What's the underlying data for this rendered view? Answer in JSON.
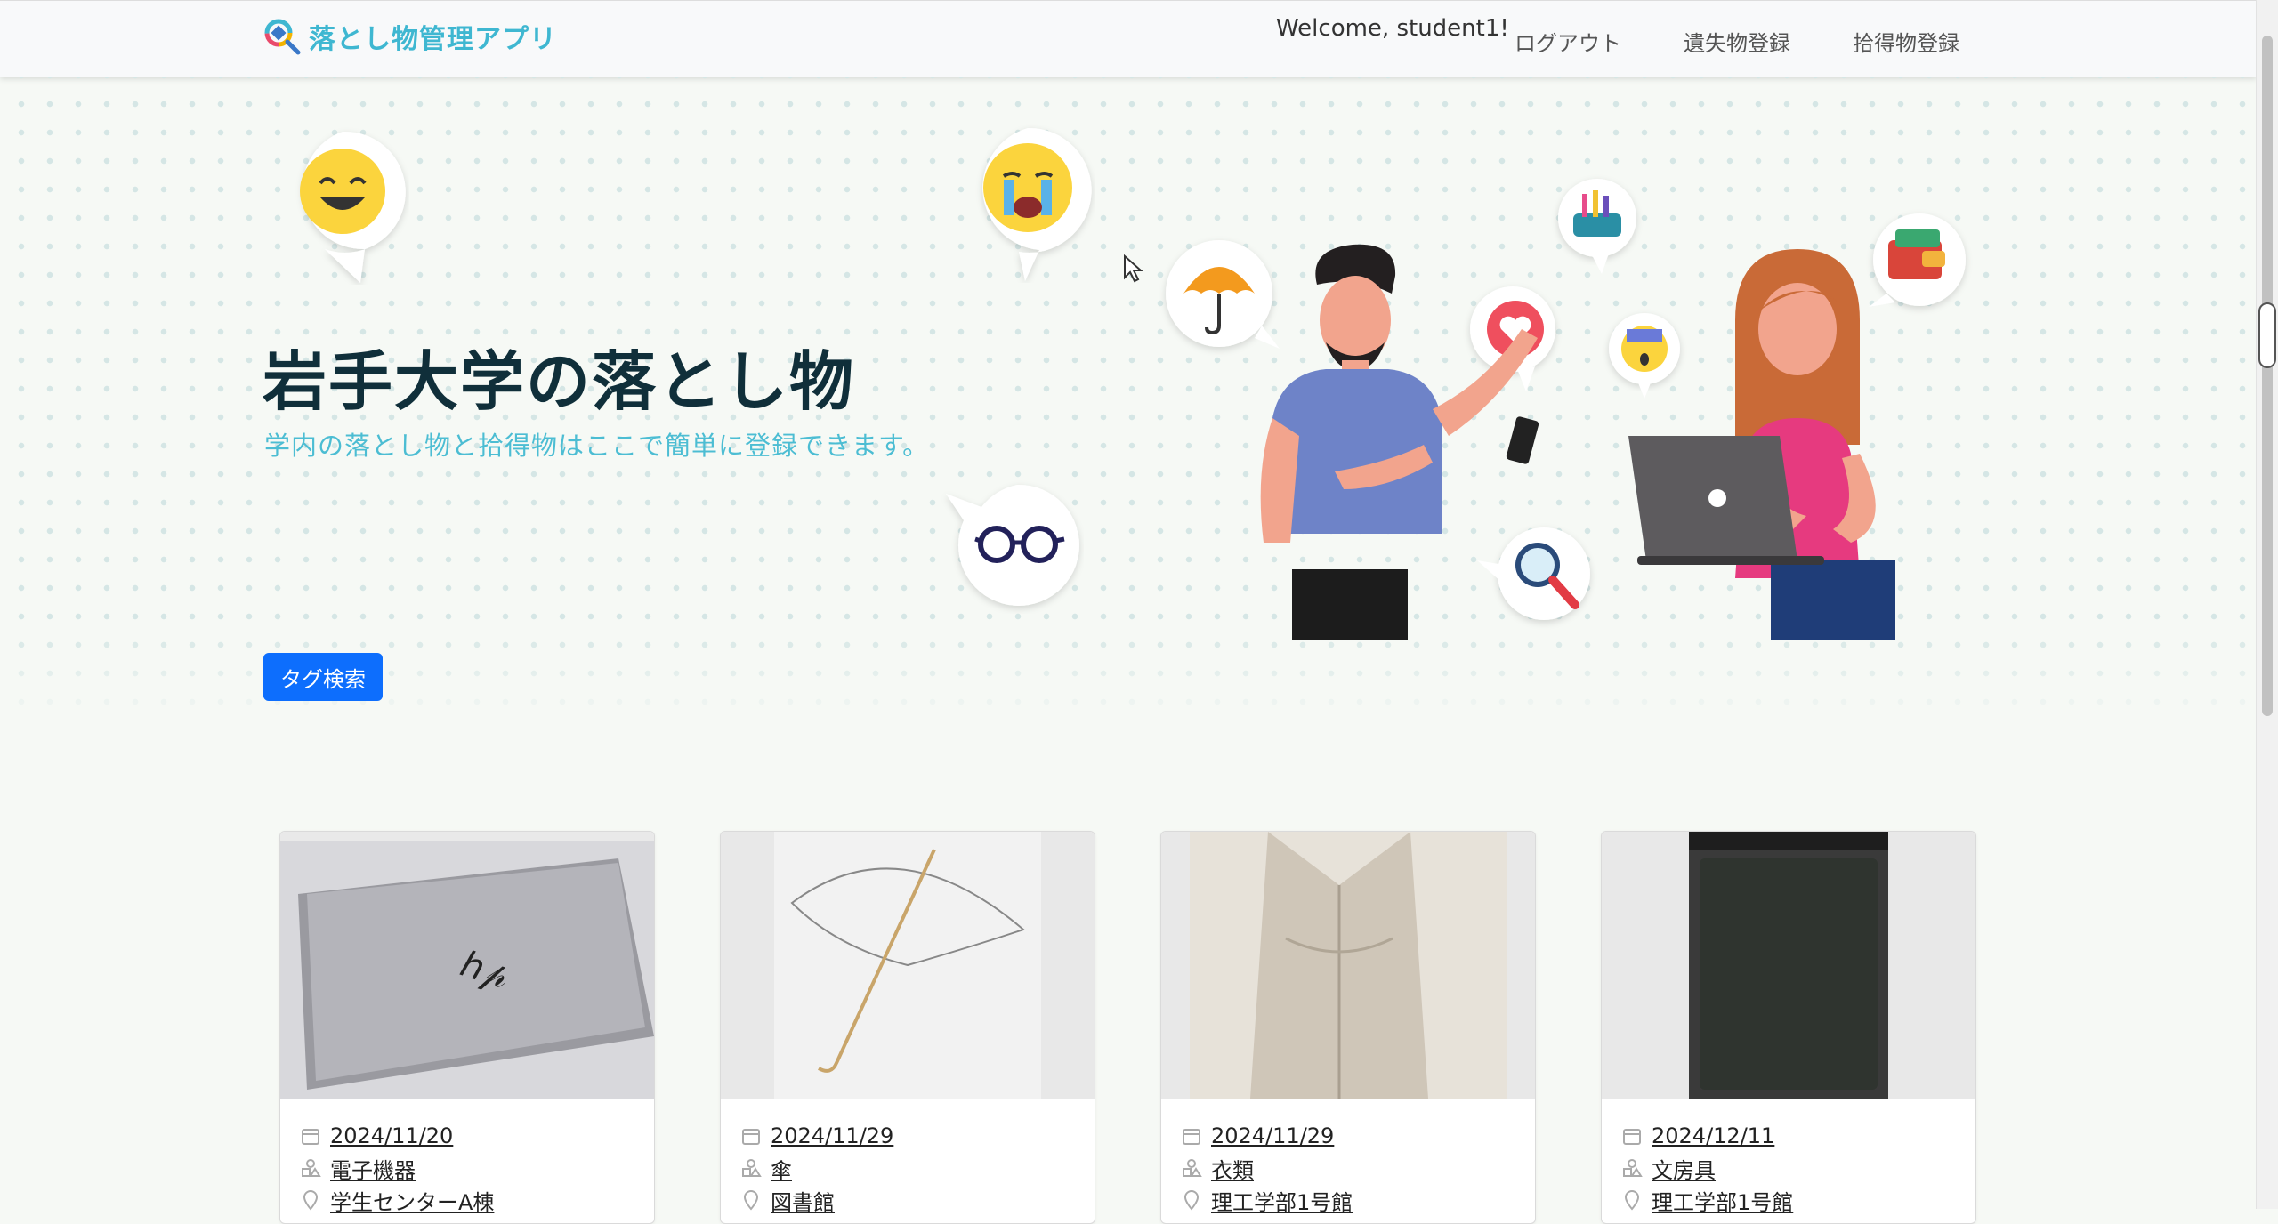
{
  "navbar": {
    "brand": "落とし物管理アプリ",
    "welcome": "Welcome, student1!",
    "links": {
      "logout": "ログアウト",
      "lost_register": "遺失物登録",
      "found_register": "拾得物登録"
    }
  },
  "hero": {
    "title": "岩手大学の落とし物",
    "subtitle": "学内の落とし物と拾得物はここで簡単に登録できます。",
    "tag_search_button": "タグ検索"
  },
  "items": [
    {
      "date": "2024/11/20",
      "category": "電子機器",
      "location": "学生センターA棟",
      "image": "laptop"
    },
    {
      "date": "2024/11/29",
      "category": "傘",
      "location": "図書館",
      "image": "umbrella"
    },
    {
      "date": "2024/11/29",
      "category": "衣類",
      "location": "理工学部1号館",
      "image": "coat"
    },
    {
      "date": "2024/12/11",
      "category": "文房具",
      "location": "理工学部1号館",
      "image": "notebook"
    }
  ],
  "colors": {
    "brand": "#3fb7d1",
    "primary_button": "#0d6efd",
    "title": "#102f3a"
  }
}
